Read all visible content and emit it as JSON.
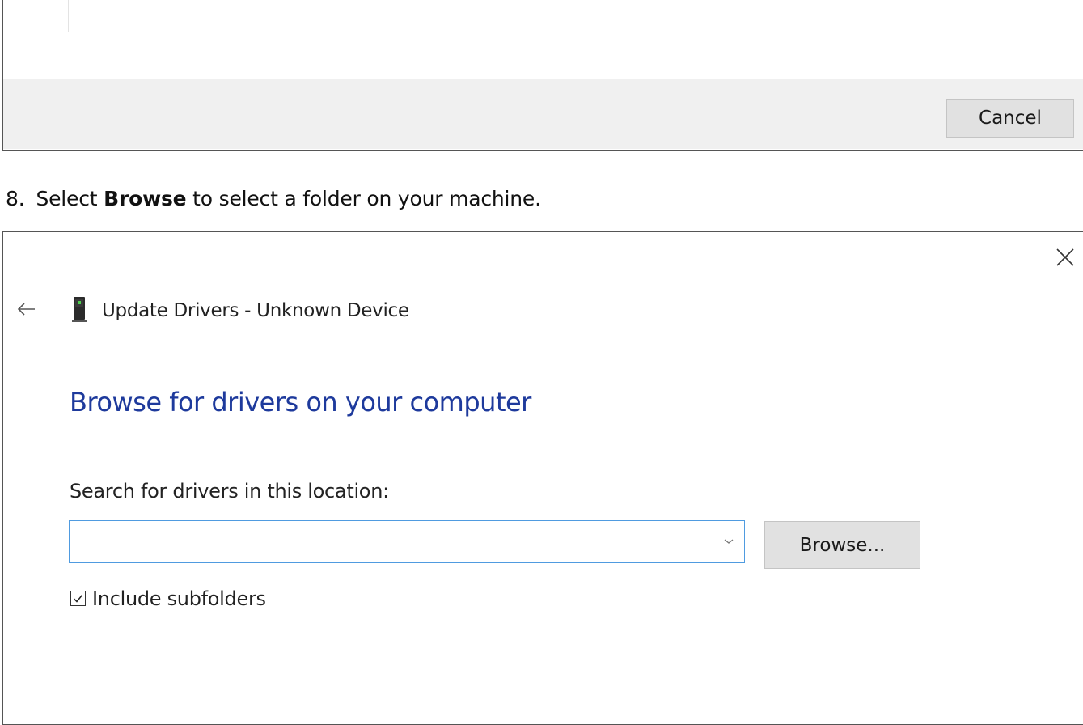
{
  "top_dialog": {
    "cancel_label": "Cancel"
  },
  "step": {
    "number": "8.",
    "prefix": "Select ",
    "bold": "Browse",
    "suffix": " to select a folder on your machine."
  },
  "dialog": {
    "title": "Update Drivers - Unknown Device",
    "heading": "Browse for drivers on your computer",
    "search_label": "Search for drivers in this location:",
    "location_value": "",
    "browse_label": "Browse...",
    "include_subfolders_label": "Include subfolders",
    "include_subfolders_checked": true
  },
  "icons": {
    "close": "close-icon",
    "back": "back-arrow-icon",
    "device": "device-icon",
    "dropdown": "chevron-down-icon",
    "check": "checkmark-icon"
  },
  "colors": {
    "heading": "#1e3a9c",
    "input_border": "#4f9be0",
    "footer_bg": "#f0f0f0",
    "button_bg": "#e1e1e1"
  }
}
